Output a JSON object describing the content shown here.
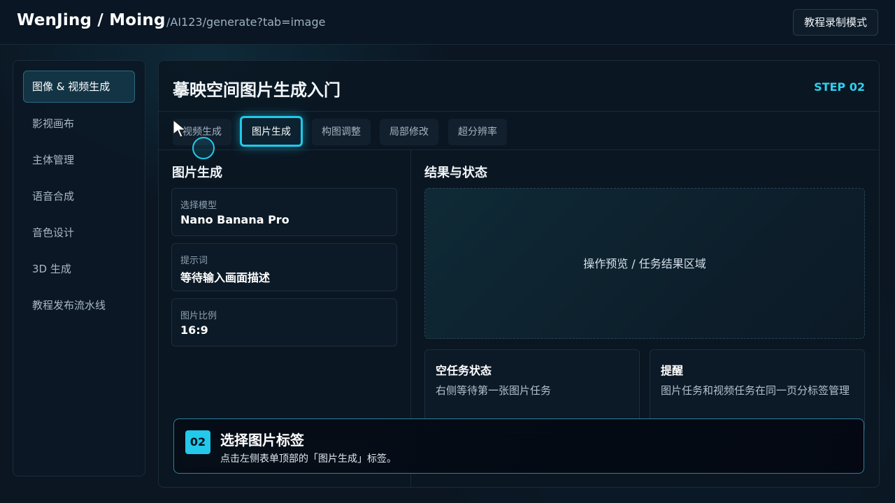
{
  "header": {
    "brand": "WenJing / Moing",
    "url": "/AI123/generate?tab=image",
    "record_button": "教程录制模式"
  },
  "sidebar": {
    "items": [
      {
        "label": "图像 & 视频生成",
        "active": true
      },
      {
        "label": "影视画布"
      },
      {
        "label": "主体管理"
      },
      {
        "label": "语音合成"
      },
      {
        "label": "音色设计"
      },
      {
        "label": "3D 生成"
      },
      {
        "label": "教程发布流水线"
      }
    ]
  },
  "main": {
    "title": "摹映空间图片生成入门",
    "step": "STEP 02",
    "tabs": [
      {
        "label": "视频生成"
      },
      {
        "label": "图片生成",
        "active": true
      },
      {
        "label": "构图调整"
      },
      {
        "label": "局部修改"
      },
      {
        "label": "超分辨率"
      }
    ],
    "form": {
      "title": "图片生成",
      "fields": [
        {
          "label": "选择模型",
          "value": "Nano Banana Pro"
        },
        {
          "label": "提示词",
          "value": "等待输入画面描述"
        },
        {
          "label": "图片比例",
          "value": "16:9"
        }
      ]
    },
    "result": {
      "title": "结果与状态",
      "preview_text": "操作预览 / 任务结果区域",
      "cards": [
        {
          "title": "空任务状态",
          "text": "右侧等待第一张图片任务"
        },
        {
          "title": "提醒",
          "text": "图片任务和视频任务在同一页分标签管理"
        }
      ]
    }
  },
  "tutorial": {
    "step_number": "02",
    "title": "选择图片标签",
    "description": "点击左侧表单顶部的「图片生成」标签。"
  },
  "colors": {
    "accent": "#22c9ea",
    "step_text": "#2fd0f0",
    "background": "#0b1622"
  }
}
